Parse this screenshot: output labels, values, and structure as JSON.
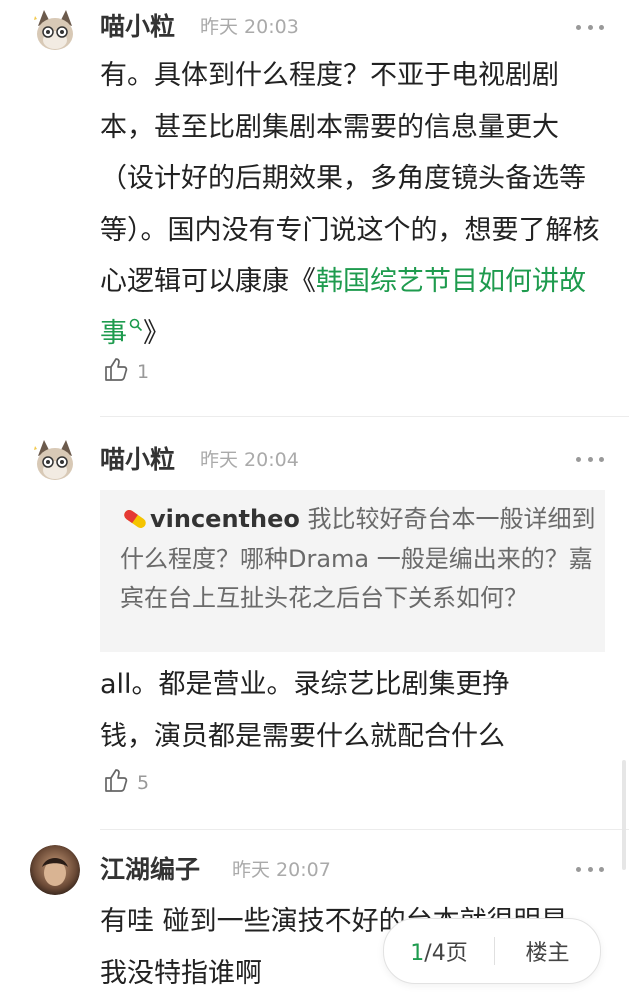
{
  "comments": [
    {
      "author": "喵小粒",
      "time": "昨天 20:03",
      "text": "有。具体到什么程度？不亚于电视剧剧本，甚至比剧集剧本需要的信息量更大（设计好的后期效果，多角度镜头备选等等）。国内没有专门说这个的，想要了解核心逻辑可以康康《",
      "link": "韩国综艺节目如何讲故事",
      "text_after": "》",
      "likes": "1"
    },
    {
      "author": "喵小粒",
      "time": "昨天 20:04",
      "quote": {
        "author": "vincentheo",
        "text": "我比较好奇台本一般详细到什么程度？哪种Drama 一般是编出来的？嘉宾在台上互扯头花之后台下关系如何？"
      },
      "text": "all。都是营业。录综艺比剧集更挣钱，演员都是需要什么就配合什么",
      "likes": "5"
    },
    {
      "author": "江湖编子",
      "time": "昨天 20:07",
      "text": "有哇 碰到一些演技不好的台本就很明显 我没特指谁啊"
    }
  ],
  "pager": {
    "current": "1",
    "total": "/4页",
    "op_label": "楼主"
  },
  "colors": {
    "link": "#1e9b4e",
    "accent": "#1e9b4e"
  }
}
